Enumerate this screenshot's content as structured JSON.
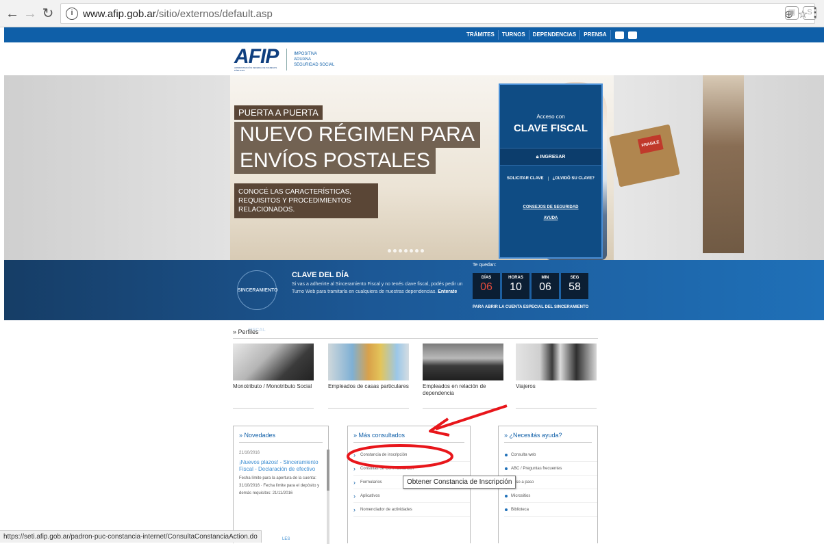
{
  "browser": {
    "url_host": "www.afip.gob.ar",
    "url_path": "/sitio/externos/default.asp",
    "back_icon": "back-arrow-icon",
    "forward_icon": "forward-arrow-icon",
    "reload_icon": "reload-icon",
    "info_icon": "info-icon",
    "zoom_icon": "zoom-icon",
    "star_icon": "star-icon",
    "menu_icon": "three-dots-icon"
  },
  "topbar": {
    "links": [
      "TRÁMITES",
      "TURNOS",
      "DEPENDENCIAS",
      "PRENSA"
    ],
    "social": [
      "twitter-icon",
      "youtube-icon"
    ],
    "color": "#0f5fa8"
  },
  "logo": {
    "mark": "AFIP",
    "subtitle": "ADMINISTRACIÓN FEDERAL DE INGRESOS PÚBLICOS",
    "lines": [
      "IMPOSITIVA",
      "ADUANA",
      "SEGURIDAD SOCIAL"
    ]
  },
  "hero": {
    "tag": "PUERTA A PUERTA",
    "title_line1": "NUEVO RÉGIMEN PARA",
    "title_line2": "ENVÍOS POSTALES",
    "desc": "CONOCÉ LAS CARACTERÍSTICAS, REQUISITOS Y PROCEDIMIENTOS RELACIONADOS.",
    "box_label": "FRAGILE"
  },
  "login": {
    "label": "Acceso con",
    "title": "CLAVE FISCAL",
    "ingresar": "INGRESAR",
    "solicitar": "SOLICITAR CLAVE",
    "olvido": "¿OLVIDÓ SU CLAVE?",
    "consejos": "CONSEJOS DE SEGURIDAD",
    "ayuda": "AYUDA"
  },
  "clave_dia": {
    "seal": "SINCERAMIENTO FISCAL",
    "title": "CLAVE DEL DÍA",
    "text": "Si vas a adherirte al Sinceramiento Fiscal y no tenés clave fiscal, podés pedir un Turno Web para tramitarla en cualquiera de nuestras dependencias.",
    "link": "Enterate",
    "te_quedan": "Te quedan:",
    "counters": [
      {
        "unit": "DÍAS",
        "value": "06"
      },
      {
        "unit": "HORAS",
        "value": "10"
      },
      {
        "unit": "MIN",
        "value": "06"
      },
      {
        "unit": "SEG",
        "value": "58"
      }
    ],
    "footer": "PARA ABRIR LA CUENTA ESPECIAL DEL SINCERAMIENTO"
  },
  "perfiles": {
    "heading": "» Perfiles",
    "cards": [
      {
        "caption": "Monotributo / Monotributo Social"
      },
      {
        "caption": "Empleados de casas particulares"
      },
      {
        "caption": "Empleados en relación de dependencia"
      },
      {
        "caption": "Viajeros"
      }
    ]
  },
  "novedades": {
    "heading": "» Novedades",
    "date": "21/10/2016",
    "title": "¡Nuevos plazos! - Sinceramiento Fiscal - Declaración de efectivo",
    "body": "Fecha límite para la apertura de la cuenta: 31/10/2016 · Fecha límite para el depósito y demás requisitos: 21/11/2016"
  },
  "mas_consultados": {
    "heading": "» Más consultados",
    "items": [
      "Constancia de inscripción",
      "Consultas de CUIT/CUIL/CDI",
      "Formularios",
      "Aplicativos",
      "Nomenclador de actividades"
    ]
  },
  "ayuda": {
    "heading": "» ¿Necesitás ayuda?",
    "items": [
      "Consulta web",
      "ABC / Preguntas frecuentes",
      "Paso a paso",
      "Micrositios",
      "Biblioteca"
    ]
  },
  "tooltip": "Obtener Constancia de Inscripción",
  "status_url": "https://seti.afip.gob.ar/padron-puc-constancia-internet/ConsultaConstanciaAction.do",
  "status_tail": "LES",
  "annotation_color": "#e8161b"
}
